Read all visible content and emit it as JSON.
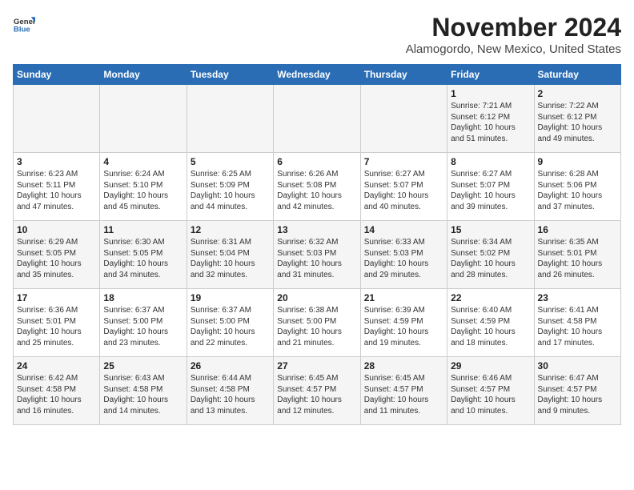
{
  "header": {
    "logo_general": "General",
    "logo_blue": "Blue",
    "month": "November 2024",
    "location": "Alamogordo, New Mexico, United States"
  },
  "days_of_week": [
    "Sunday",
    "Monday",
    "Tuesday",
    "Wednesday",
    "Thursday",
    "Friday",
    "Saturday"
  ],
  "weeks": [
    [
      {
        "day": "",
        "info": ""
      },
      {
        "day": "",
        "info": ""
      },
      {
        "day": "",
        "info": ""
      },
      {
        "day": "",
        "info": ""
      },
      {
        "day": "",
        "info": ""
      },
      {
        "day": "1",
        "info": "Sunrise: 7:21 AM\nSunset: 6:12 PM\nDaylight: 10 hours\nand 51 minutes."
      },
      {
        "day": "2",
        "info": "Sunrise: 7:22 AM\nSunset: 6:12 PM\nDaylight: 10 hours\nand 49 minutes."
      }
    ],
    [
      {
        "day": "3",
        "info": "Sunrise: 6:23 AM\nSunset: 5:11 PM\nDaylight: 10 hours\nand 47 minutes."
      },
      {
        "day": "4",
        "info": "Sunrise: 6:24 AM\nSunset: 5:10 PM\nDaylight: 10 hours\nand 45 minutes."
      },
      {
        "day": "5",
        "info": "Sunrise: 6:25 AM\nSunset: 5:09 PM\nDaylight: 10 hours\nand 44 minutes."
      },
      {
        "day": "6",
        "info": "Sunrise: 6:26 AM\nSunset: 5:08 PM\nDaylight: 10 hours\nand 42 minutes."
      },
      {
        "day": "7",
        "info": "Sunrise: 6:27 AM\nSunset: 5:07 PM\nDaylight: 10 hours\nand 40 minutes."
      },
      {
        "day": "8",
        "info": "Sunrise: 6:27 AM\nSunset: 5:07 PM\nDaylight: 10 hours\nand 39 minutes."
      },
      {
        "day": "9",
        "info": "Sunrise: 6:28 AM\nSunset: 5:06 PM\nDaylight: 10 hours\nand 37 minutes."
      }
    ],
    [
      {
        "day": "10",
        "info": "Sunrise: 6:29 AM\nSunset: 5:05 PM\nDaylight: 10 hours\nand 35 minutes."
      },
      {
        "day": "11",
        "info": "Sunrise: 6:30 AM\nSunset: 5:05 PM\nDaylight: 10 hours\nand 34 minutes."
      },
      {
        "day": "12",
        "info": "Sunrise: 6:31 AM\nSunset: 5:04 PM\nDaylight: 10 hours\nand 32 minutes."
      },
      {
        "day": "13",
        "info": "Sunrise: 6:32 AM\nSunset: 5:03 PM\nDaylight: 10 hours\nand 31 minutes."
      },
      {
        "day": "14",
        "info": "Sunrise: 6:33 AM\nSunset: 5:03 PM\nDaylight: 10 hours\nand 29 minutes."
      },
      {
        "day": "15",
        "info": "Sunrise: 6:34 AM\nSunset: 5:02 PM\nDaylight: 10 hours\nand 28 minutes."
      },
      {
        "day": "16",
        "info": "Sunrise: 6:35 AM\nSunset: 5:01 PM\nDaylight: 10 hours\nand 26 minutes."
      }
    ],
    [
      {
        "day": "17",
        "info": "Sunrise: 6:36 AM\nSunset: 5:01 PM\nDaylight: 10 hours\nand 25 minutes."
      },
      {
        "day": "18",
        "info": "Sunrise: 6:37 AM\nSunset: 5:00 PM\nDaylight: 10 hours\nand 23 minutes."
      },
      {
        "day": "19",
        "info": "Sunrise: 6:37 AM\nSunset: 5:00 PM\nDaylight: 10 hours\nand 22 minutes."
      },
      {
        "day": "20",
        "info": "Sunrise: 6:38 AM\nSunset: 5:00 PM\nDaylight: 10 hours\nand 21 minutes."
      },
      {
        "day": "21",
        "info": "Sunrise: 6:39 AM\nSunset: 4:59 PM\nDaylight: 10 hours\nand 19 minutes."
      },
      {
        "day": "22",
        "info": "Sunrise: 6:40 AM\nSunset: 4:59 PM\nDaylight: 10 hours\nand 18 minutes."
      },
      {
        "day": "23",
        "info": "Sunrise: 6:41 AM\nSunset: 4:58 PM\nDaylight: 10 hours\nand 17 minutes."
      }
    ],
    [
      {
        "day": "24",
        "info": "Sunrise: 6:42 AM\nSunset: 4:58 PM\nDaylight: 10 hours\nand 16 minutes."
      },
      {
        "day": "25",
        "info": "Sunrise: 6:43 AM\nSunset: 4:58 PM\nDaylight: 10 hours\nand 14 minutes."
      },
      {
        "day": "26",
        "info": "Sunrise: 6:44 AM\nSunset: 4:58 PM\nDaylight: 10 hours\nand 13 minutes."
      },
      {
        "day": "27",
        "info": "Sunrise: 6:45 AM\nSunset: 4:57 PM\nDaylight: 10 hours\nand 12 minutes."
      },
      {
        "day": "28",
        "info": "Sunrise: 6:45 AM\nSunset: 4:57 PM\nDaylight: 10 hours\nand 11 minutes."
      },
      {
        "day": "29",
        "info": "Sunrise: 6:46 AM\nSunset: 4:57 PM\nDaylight: 10 hours\nand 10 minutes."
      },
      {
        "day": "30",
        "info": "Sunrise: 6:47 AM\nSunset: 4:57 PM\nDaylight: 10 hours\nand 9 minutes."
      }
    ]
  ]
}
